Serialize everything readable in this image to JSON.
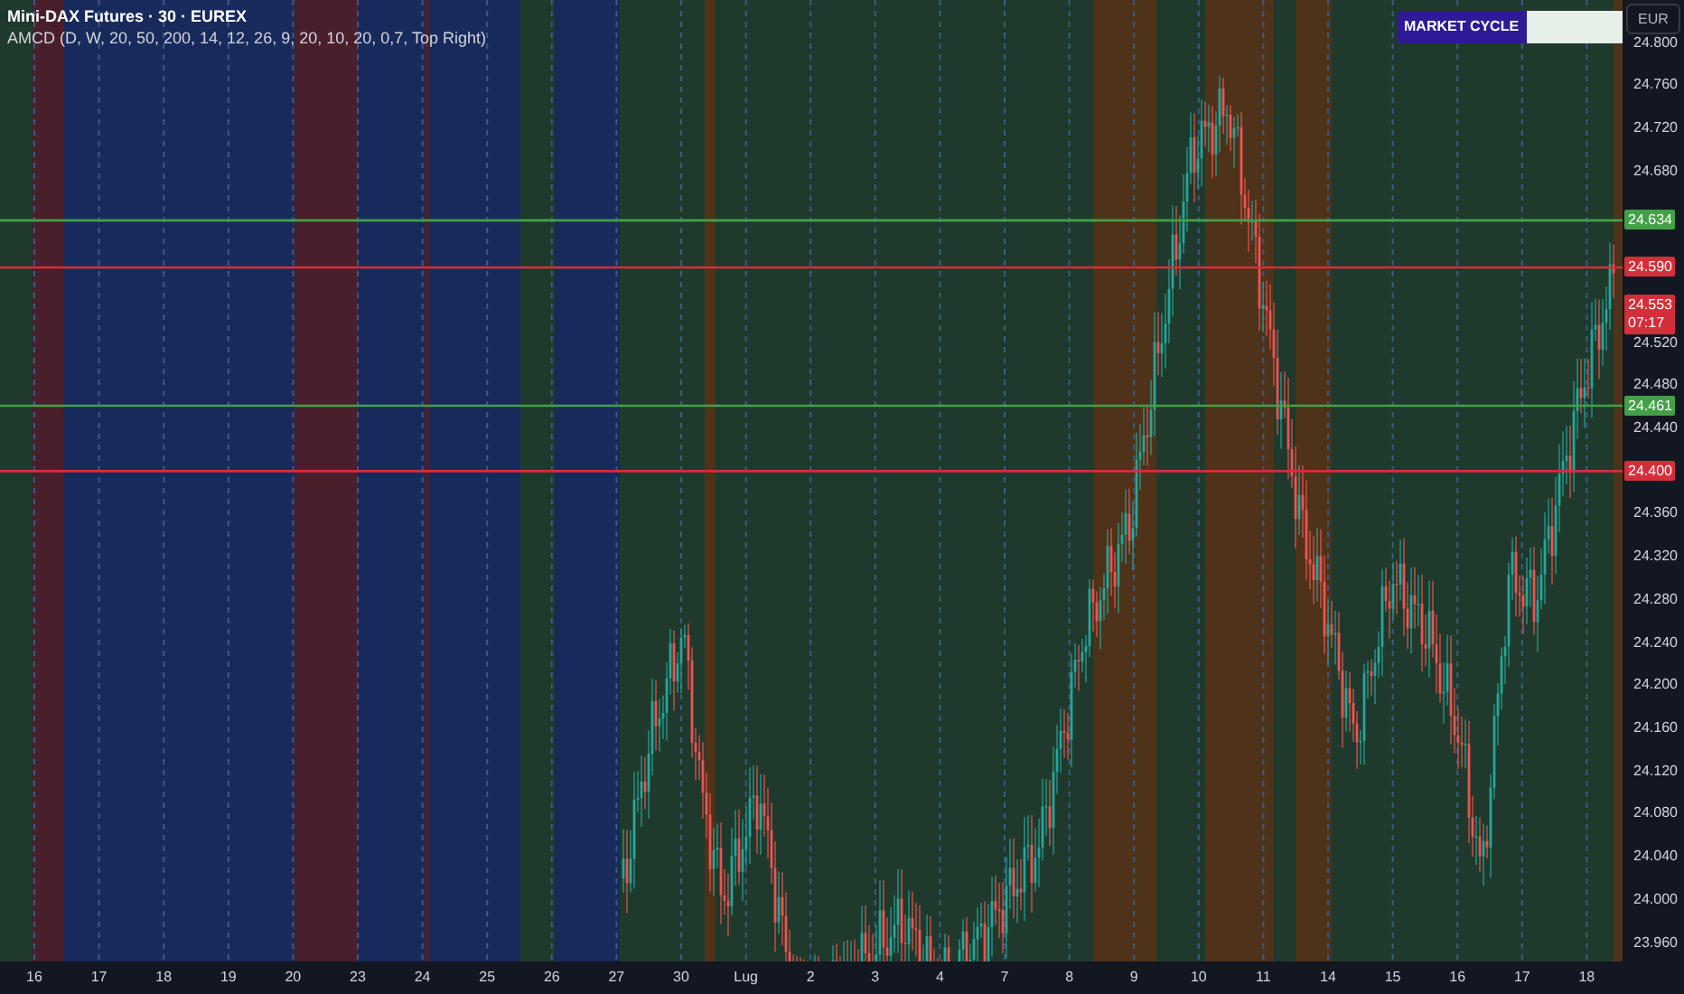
{
  "header": {
    "title": "Mini-DAX Futures · 30 · EUREX",
    "indicator": "AMCD (D, W, 20, 50, 200, 14, 12, 26, 9, 20, 10, 20, 0,7, Top Right)"
  },
  "market_cycle": {
    "label": "MARKET CYCLE"
  },
  "currency_button": "EUR",
  "price_ticks": [
    "24.800",
    "24.760",
    "24.720",
    "24.680",
    "24.520",
    "24.480",
    "24.440",
    "24.360",
    "24.320",
    "24.280",
    "24.240",
    "24.200",
    "24.160",
    "24.120",
    "24.080",
    "24.040",
    "24.000",
    "23.960"
  ],
  "price_levels": [
    {
      "label": "24.634",
      "kind": "support"
    },
    {
      "label": "24.590",
      "kind": "resistance"
    },
    {
      "label": "24.461",
      "kind": "support"
    },
    {
      "label": "24.400",
      "kind": "resistance"
    }
  ],
  "last_price": {
    "price": "24.553",
    "countdown": "07:17"
  },
  "time_labels": [
    "16",
    "17",
    "18",
    "19",
    "20",
    "23",
    "24",
    "25",
    "26",
    "27",
    "30",
    "Lug",
    "2",
    "3",
    "4",
    "7",
    "8",
    "9",
    "10",
    "11",
    "14",
    "15",
    "16",
    "17",
    "18"
  ]
}
